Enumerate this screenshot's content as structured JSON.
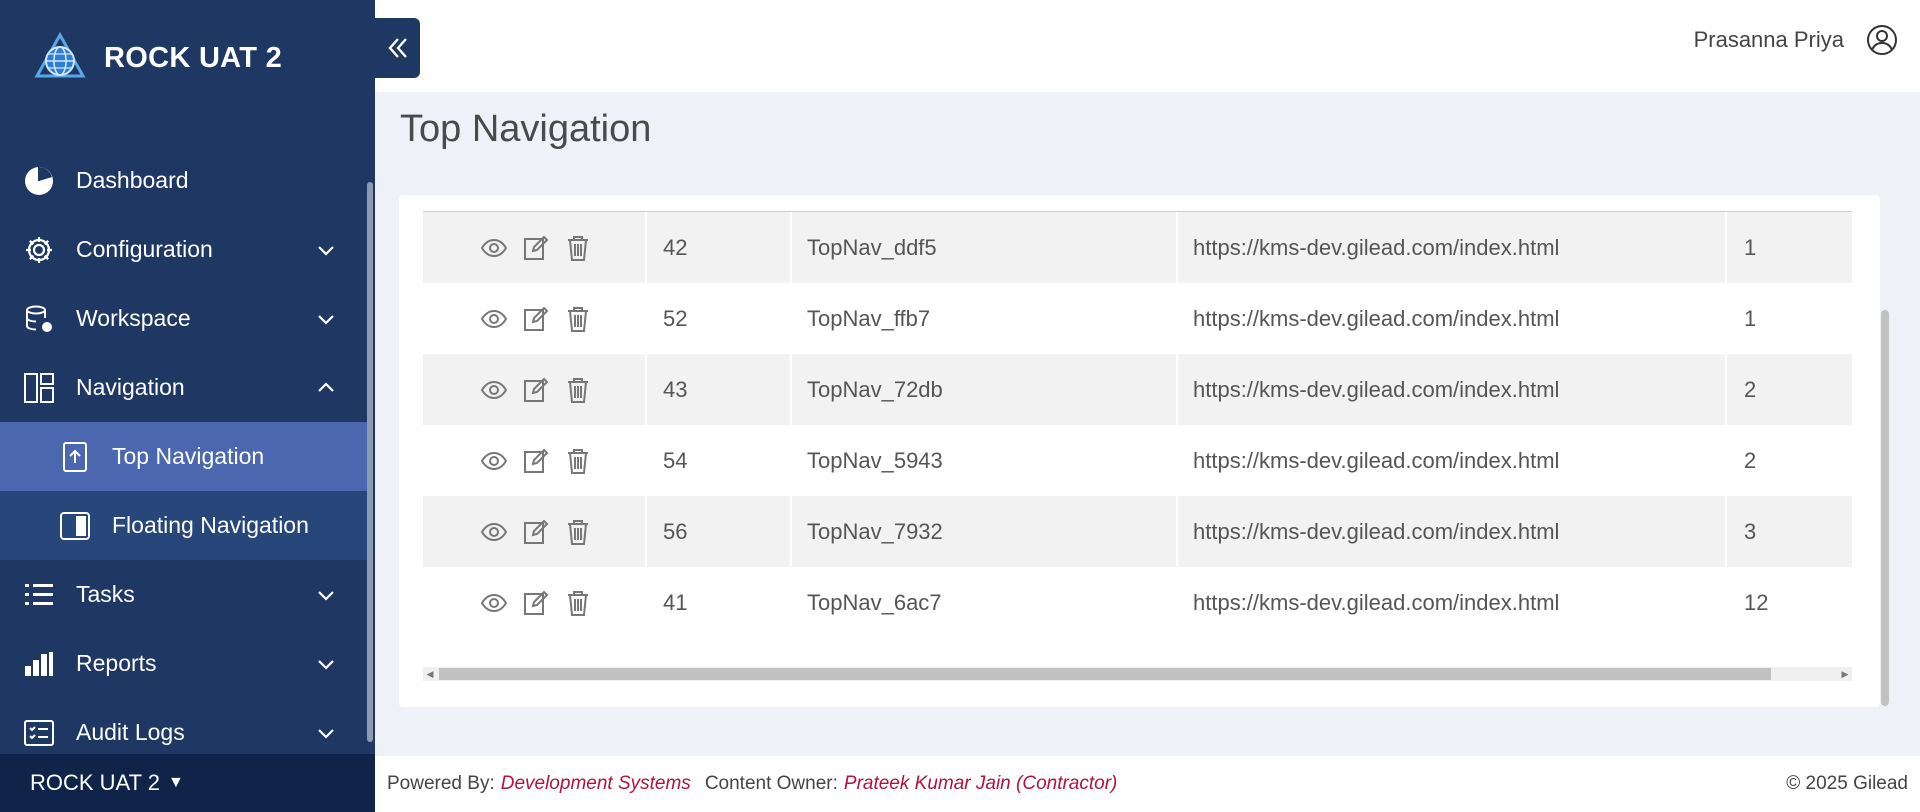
{
  "app": {
    "title": "ROCK UAT 2"
  },
  "sidebar": {
    "items": [
      {
        "label": "Dashboard",
        "icon": "pie-chart-icon"
      },
      {
        "label": "Configuration",
        "icon": "gear-icon"
      },
      {
        "label": "Workspace",
        "icon": "database-gear-icon"
      },
      {
        "label": "Navigation",
        "icon": "layout-icon"
      },
      {
        "label": "Tasks",
        "icon": "list-icon"
      },
      {
        "label": "Reports",
        "icon": "bar-chart-icon"
      },
      {
        "label": "Audit Logs",
        "icon": "checklist-icon"
      }
    ],
    "sub_items": [
      {
        "label": "Top Navigation",
        "icon": "upload-file-icon"
      },
      {
        "label": "Floating Navigation",
        "icon": "sidebar-panel-icon"
      }
    ],
    "footer_env": "ROCK UAT 2"
  },
  "header": {
    "user_name": "Prasanna Priya"
  },
  "page": {
    "title": "Top Navigation"
  },
  "table": {
    "rows": [
      {
        "id": "42",
        "name": "TopNav_ddf5",
        "url": "https://kms-dev.gilead.com/index.html",
        "order": "1"
      },
      {
        "id": "52",
        "name": "TopNav_ffb7",
        "url": "https://kms-dev.gilead.com/index.html",
        "order": "1"
      },
      {
        "id": "43",
        "name": "TopNav_72db",
        "url": "https://kms-dev.gilead.com/index.html",
        "order": "2"
      },
      {
        "id": "54",
        "name": "TopNav_5943",
        "url": "https://kms-dev.gilead.com/index.html",
        "order": "2"
      },
      {
        "id": "56",
        "name": "TopNav_7932",
        "url": "https://kms-dev.gilead.com/index.html",
        "order": "3"
      },
      {
        "id": "41",
        "name": "TopNav_6ac7",
        "url": "https://kms-dev.gilead.com/index.html",
        "order": "12"
      }
    ]
  },
  "footer": {
    "powered_label": "Powered By:",
    "powered_value": "Development Systems",
    "owner_label": "Content Owner:",
    "owner_value": "Prateek Kumar Jain (Contractor)",
    "copyright": "© 2025 Gilead"
  },
  "colors": {
    "sidebar": "#1f3863",
    "active": "#4a67b0",
    "accent_red": "#b2133c"
  }
}
